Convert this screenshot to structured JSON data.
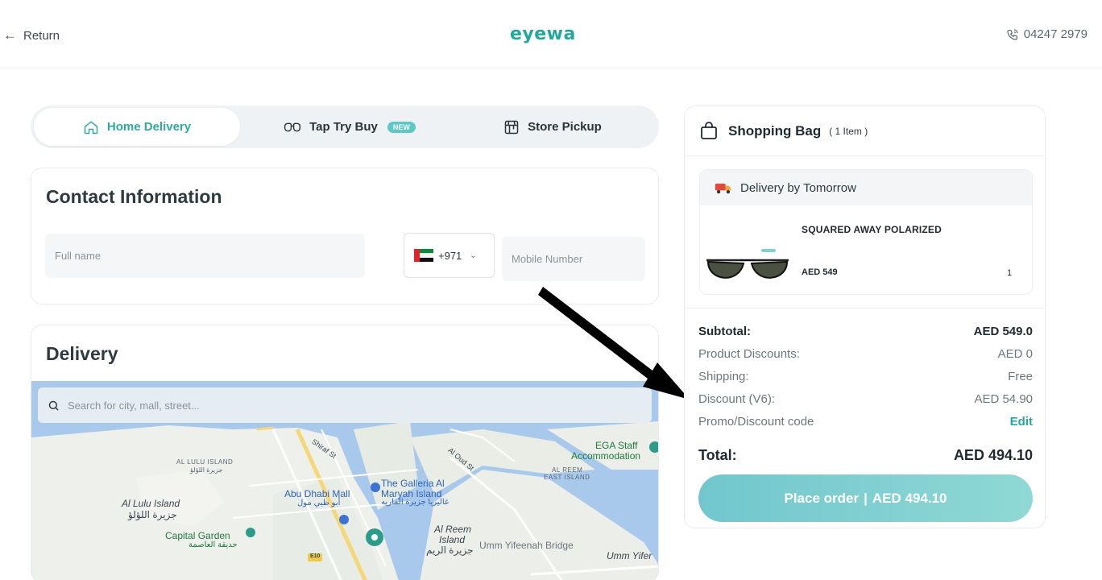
{
  "header": {
    "return_label": "Return",
    "logo": "eyewa",
    "phone": "04247 2979"
  },
  "tabs": [
    {
      "label": "Home Delivery",
      "icon": "home-icon",
      "active": true
    },
    {
      "label": "Tap Try Buy",
      "icon": "glasses-icon",
      "badge": "NEW",
      "active": false
    },
    {
      "label": "Store Pickup",
      "icon": "store-icon",
      "active": false
    }
  ],
  "contact": {
    "title": "Contact Information",
    "full_name_placeholder": "Full name",
    "country_code": "+971",
    "mobile_placeholder": "Mobile Number"
  },
  "delivery": {
    "title": "Delivery",
    "search_placeholder": "Search for city, mall, street...",
    "map_labels": {
      "al_lulu_island_en": "AL LULU ISLAND",
      "al_lulu_island_ar": "جزيرة اللؤلؤ",
      "al_lulu_island": "Al Lulu Island",
      "al_lulu_island_ar2": "جزيرة اللؤلؤ",
      "capital_garden": "Capital Garden",
      "capital_garden_ar": "حديقة العاصمة",
      "abu_dhabi_mall": "Abu Dhabi Mall",
      "abu_dhabi_mall_ar": "أبو ظبي مول",
      "galleria_1": "The Galleria Al",
      "galleria_2": "Maryah Island",
      "galleria_ar": "غاليريا جزيرة الماريه",
      "al_reem_1": "Al Reem",
      "al_reem_2": "Island",
      "al_reem_ar": "جزيرة الريم",
      "umm_yifeenah_bridge": "Umm Yifeenah Bridge",
      "umm_yifer": "Umm Yifer",
      "ega_staff": "EGA Staff",
      "accommodation": "Accommodation",
      "al_reem_east_1": "AL REEM",
      "al_reem_east_2": "EAST ISLAND",
      "shiraf_st": "Shiraf St",
      "al_oud_st": "Al Oud St",
      "road_e10": "E10"
    }
  },
  "bag": {
    "title": "Shopping Bag",
    "count": "( 1 Item )",
    "delivery_banner": "Delivery by Tomorrow",
    "product": {
      "name": "SQUARED AWAY POLARIZED",
      "price": "AED 549",
      "qty": "1"
    },
    "summary": [
      {
        "key": "Subtotal:",
        "value": "AED 549.0",
        "strong": true
      },
      {
        "key": "Product Discounts:",
        "value": "AED 0"
      },
      {
        "key": "Shipping:",
        "value": "Free"
      },
      {
        "key": "Discount (V6):",
        "value": "AED 54.90"
      },
      {
        "key": "Promo/Discount code",
        "value": "Edit"
      }
    ],
    "total_label": "Total:",
    "total_value": "AED 494.10",
    "place_order_label": "Place order",
    "place_order_sep": "|",
    "place_order_amount": "AED 494.10"
  },
  "colors": {
    "accent": "#2fa99e",
    "button": "#7ccfd1",
    "map_water": "#a9c9ec"
  }
}
